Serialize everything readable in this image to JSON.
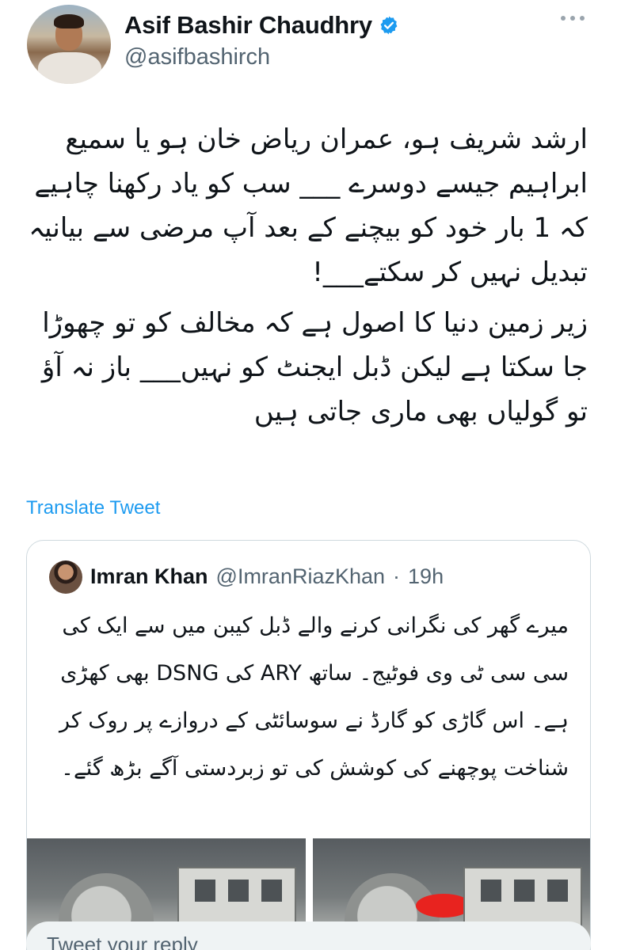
{
  "tweet": {
    "author": {
      "display_name": "Asif Bashir Chaudhry",
      "handle": "@asifbashirch",
      "verified_icon": "verified-badge-icon",
      "more_icon": "more-options-icon"
    },
    "text_paragraphs": [
      "ارشد شریف ہو، عمران ریاض خان ہو یا سمیع ابراہیم جیسے دوسرے ___ سب کو یاد رکھنا چاہیے کہ 1 بار خود کو بیچنے کے بعد آپ مرضی سے بیانیہ تبدیل نہیں کر سکتے___!",
      "زیر زمین دنیا کا اصول ہے کہ مخالف کو تو چھوڑا جا سکتا ہے لیکن ڈبل ایجنٹ کو نہیں___ باز نہ آؤ تو گولیاں بھی ماری جاتی ہیں"
    ],
    "translate_label": "Translate Tweet"
  },
  "quote": {
    "display_name": "Imran Khan",
    "handle": "@ImranRiazKhan",
    "separator": "·",
    "time": "19h",
    "text": "میرے گھر کی نگرانی کرنے والے ڈبل کیبن میں سے ایک کی سی سی ٹی وی فوٹیج۔ ساتھ ARY کی DSNG بھی کھڑی ہے۔ اس گاڑی کو گارڈ نے سوسائٹی کے دروازے پر روک کر شناخت پوچھنے کی کوشش کی تو زبردستی آگے بڑھ گئے۔"
  },
  "reply": {
    "placeholder": "Tweet your reply"
  },
  "colors": {
    "link": "#1d9bf0",
    "secondary_text": "#536471",
    "border": "#cfd9de",
    "reply_bg": "#eff3f4"
  }
}
